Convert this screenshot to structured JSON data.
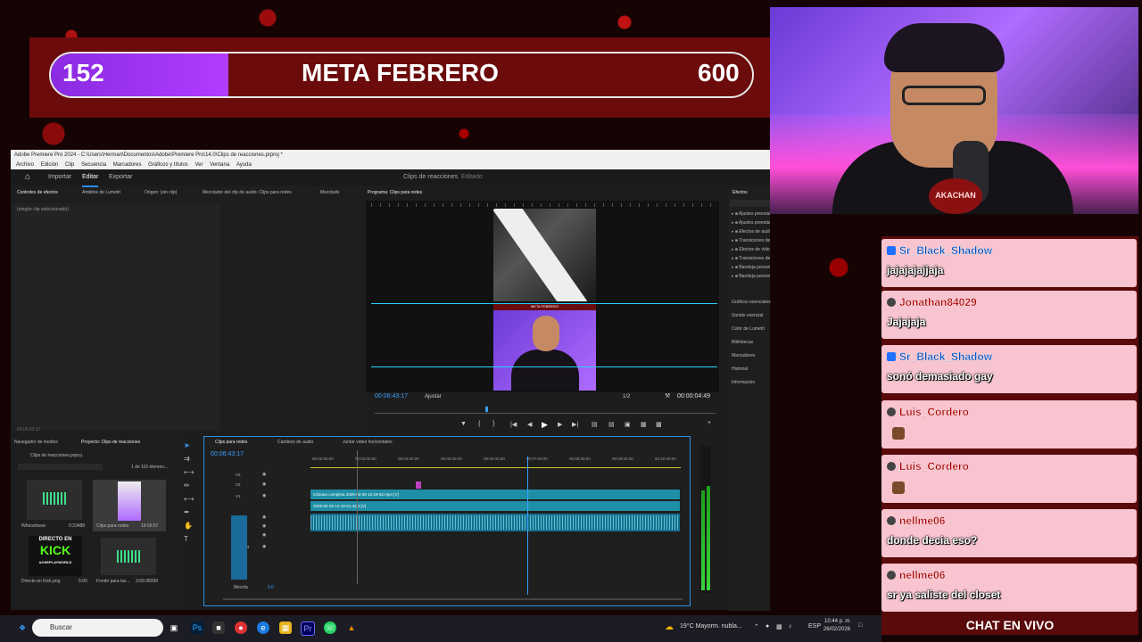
{
  "goal": {
    "current": "152",
    "title": "META FEBRERO",
    "target": "600",
    "progress_fraction": 0.253
  },
  "webcam": {
    "logo_text": "AKACHAN"
  },
  "premiere": {
    "title": "Adobe Premiere Pro 2024 - C:\\Users\\Herman\\Documentos\\Adobe\\Premiere Pro\\14.0\\Clips de reacciones.prproj *",
    "menu": [
      "Archivo",
      "Edición",
      "Clip",
      "Secuencia",
      "Marcadores",
      "Gráficos y títulos",
      "Ver",
      "Ventana",
      "Ayuda"
    ],
    "workspaces": {
      "import": "Importar",
      "edit": "Editar",
      "export": "Exportar"
    },
    "project_name": "Clips de reacciones",
    "edited_label": "Editado",
    "source_tabs": {
      "effect_controls": "Controles de efectos",
      "lumetri": "Ámbitos de Lumetri",
      "source": "Origen: (sin clip)",
      "audio_mixer": "Mezclador del clip de audio: Clips para redes",
      "mix": "Mezclado"
    },
    "no_clip": "(ningún clip seleccionado)",
    "source_tc": "00:06:43:17",
    "program_tab": "Programa: Clips para redes",
    "program_tc": "00:06:43:17",
    "fit": "Ajustar",
    "quality": "1/2",
    "duration": "00:00:04:49",
    "preview_caption": "META FEBRERO",
    "effects": {
      "tab": "Efectos",
      "folders": [
        "Ajustes preestablecidos",
        "Ajustes preestablecidos de Lumetri",
        "Efectos de audio",
        "Transiciones de audio",
        "Efectos de vídeo",
        "Transiciones de vídeo",
        "Bandeja personalizada 01",
        "Bandeja personalizada 02"
      ],
      "panels": [
        "Gráficos esenciales",
        "Sonido esencial",
        "Color de Lumetri",
        "Bibliotecas",
        "Marcadores",
        "Historial",
        "Información"
      ]
    },
    "project": {
      "tabs": {
        "media": "Navegador de medios",
        "project": "Proyecto: Clips de reacciones"
      },
      "file": "Clips de reacciones.prproj",
      "count": "1 de 110 elemen...",
      "items": [
        {
          "name": "Whooshwav",
          "dur": "0:23488"
        },
        {
          "name": "Clips para redes",
          "dur": "19:56:57"
        },
        {
          "name": "Directo en Kick.png",
          "dur": "5:00"
        },
        {
          "name": "Fondo para las...",
          "dur": "3:59:38399"
        }
      ],
      "kick": {
        "top": "DIRECTO EN",
        "big": "KICK",
        "handle": "ACHEPLAYWORLD"
      }
    },
    "timeline": {
      "tabs": {
        "seq": "Clips para redes",
        "audio": "Cambios de audio",
        "join": "Juntar video horizontales"
      },
      "tc": "00:06:43:17",
      "ruler": [
        "00:02:00:00",
        "00:03:00:00",
        "00:04:00:00",
        "00:05:00:00",
        "00:06:00:00",
        "00:07:00:00",
        "00:08:00:00",
        "00:09:00:00",
        "00:10:00:00"
      ],
      "clip_v2": "Cámara completa 2026-02-26 12-19-52.mp4 [V]",
      "clip_v1": "2026-02-26 12-19-51.mp4 [V]",
      "tracks": [
        "V3",
        "V2",
        "V1",
        "A1",
        "A2",
        "A3",
        "Audio 3"
      ],
      "mix": "Mezcla",
      "mix_val": "0.0"
    }
  },
  "chat": {
    "messages": [
      {
        "user": "Sr_Black_Shadow",
        "text": "jajajajajjaja"
      },
      {
        "user": "Jonathan84029",
        "text": "Jajajaja"
      },
      {
        "user": "Sr_Black_Shadow",
        "text": "sonó demasiado gay"
      },
      {
        "user": "Luis_Cordero",
        "text": ""
      },
      {
        "user": "Luis_Cordero",
        "text": ""
      },
      {
        "user": "nellme06",
        "text": "donde decia eso?"
      },
      {
        "user": "nellme06",
        "text": "sr ya saliste del closet"
      }
    ],
    "footer": "CHAT EN VIVO"
  },
  "taskbar": {
    "search_placeholder": "Buscar",
    "weather": "19°C  Mayorm. nubla...",
    "lang": "ESP",
    "time": "10:44 p. m.",
    "date": "26/02/2026"
  },
  "colors": {
    "goal_fill": "#b23cff",
    "timeline_accent": "#2d8ceb",
    "clip": "#1e8fa6",
    "chat_bg": "#f7c4cf"
  }
}
